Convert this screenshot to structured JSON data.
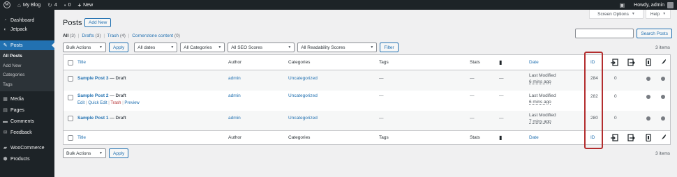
{
  "adminbar": {
    "site_name": "My Blog",
    "updates_count": "4",
    "comments_count": "0",
    "new_label": "New",
    "howdy": "Howdy, admin"
  },
  "sidebar": {
    "items": [
      {
        "label": "Dashboard",
        "icon": "dashboard-icon"
      },
      {
        "label": "Jetpack",
        "icon": "jetpack-icon"
      },
      {
        "label": "Posts",
        "icon": "pin-icon"
      },
      {
        "label": "Media",
        "icon": "media-icon"
      },
      {
        "label": "Pages",
        "icon": "pages-icon"
      },
      {
        "label": "Comments",
        "icon": "comments-icon"
      },
      {
        "label": "Feedback",
        "icon": "feedback-icon"
      },
      {
        "label": "WooCommerce",
        "icon": "woocommerce-icon"
      },
      {
        "label": "Products",
        "icon": "products-icon"
      }
    ],
    "submenu": [
      "All Posts",
      "Add New",
      "Categories",
      "Tags"
    ]
  },
  "header": {
    "screen_options": "Screen Options",
    "help": "Help",
    "title": "Posts",
    "add_new": "Add New"
  },
  "views": {
    "all": "All",
    "all_count": "(3)",
    "drafts": "Drafts",
    "drafts_count": "(3)",
    "trash": "Trash",
    "trash_count": "(4)",
    "cornerstone": "Cornerstone content",
    "cornerstone_count": "(0)"
  },
  "search": {
    "placeholder": "",
    "button": "Search Posts"
  },
  "filters": {
    "bulk_actions": "Bulk Actions",
    "apply": "Apply",
    "dates": "All dates",
    "categories": "All Categories",
    "seo": "All SEO Scores",
    "readability": "All Readability Scores",
    "filter": "Filter",
    "items_count": "3 items"
  },
  "columns": {
    "title": "Title",
    "author": "Author",
    "categories": "Categories",
    "tags": "Tags",
    "stats": "Stats",
    "date": "Date",
    "id": "ID"
  },
  "posts": [
    {
      "title": "Sample Post 3",
      "state": " — Draft",
      "author": "admin",
      "category": "Uncategorized",
      "tags": "—",
      "stats": "—",
      "date_status": "Last Modified",
      "date_ago": "6 mins ago",
      "id": "284",
      "links": "0"
    },
    {
      "title": "Sample Post 2",
      "state": " — Draft",
      "author": "admin",
      "category": "Uncategorized",
      "tags": "—",
      "stats": "—",
      "date_status": "Last Modified",
      "date_ago": "6 mins ago",
      "id": "282",
      "links": "0"
    },
    {
      "title": "Sample Post 1",
      "state": " — Draft",
      "author": "admin",
      "category": "Uncategorized",
      "tags": "—",
      "stats": "—",
      "date_status": "Last Modified",
      "date_ago": "7 mins ago",
      "id": "280",
      "links": "0"
    }
  ],
  "row_actions": {
    "edit": "Edit",
    "quick_edit": "Quick Edit",
    "trash": "Trash",
    "preview": "Preview",
    "sep": "|"
  },
  "colors": {
    "accent": "#2271b1",
    "adminbar": "#1d2327",
    "highlight": "#b32d2e"
  }
}
